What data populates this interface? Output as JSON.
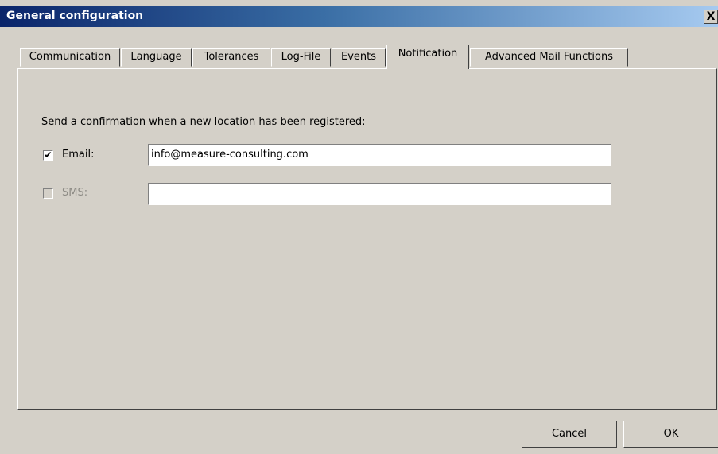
{
  "window": {
    "title": "General configuration",
    "close_symbol": "X"
  },
  "tabs": [
    {
      "label": "Communication"
    },
    {
      "label": "Language"
    },
    {
      "label": "Tolerances"
    },
    {
      "label": "Log-File"
    },
    {
      "label": "Events"
    },
    {
      "label": "Notification",
      "active": true
    },
    {
      "label": "Advanced Mail Functions"
    }
  ],
  "notification": {
    "prompt": "Send a confirmation when a new location has been registered:",
    "email": {
      "label": "Email:",
      "checked": true,
      "value": "info@measure-consulting.com"
    },
    "sms": {
      "label": "SMS:",
      "checked": false,
      "enabled": false,
      "value": ""
    }
  },
  "buttons": {
    "cancel": "Cancel",
    "ok": "OK"
  },
  "colors": {
    "face": "#d4d0c8",
    "title_start": "#0a246a",
    "title_end": "#a6caf0"
  }
}
